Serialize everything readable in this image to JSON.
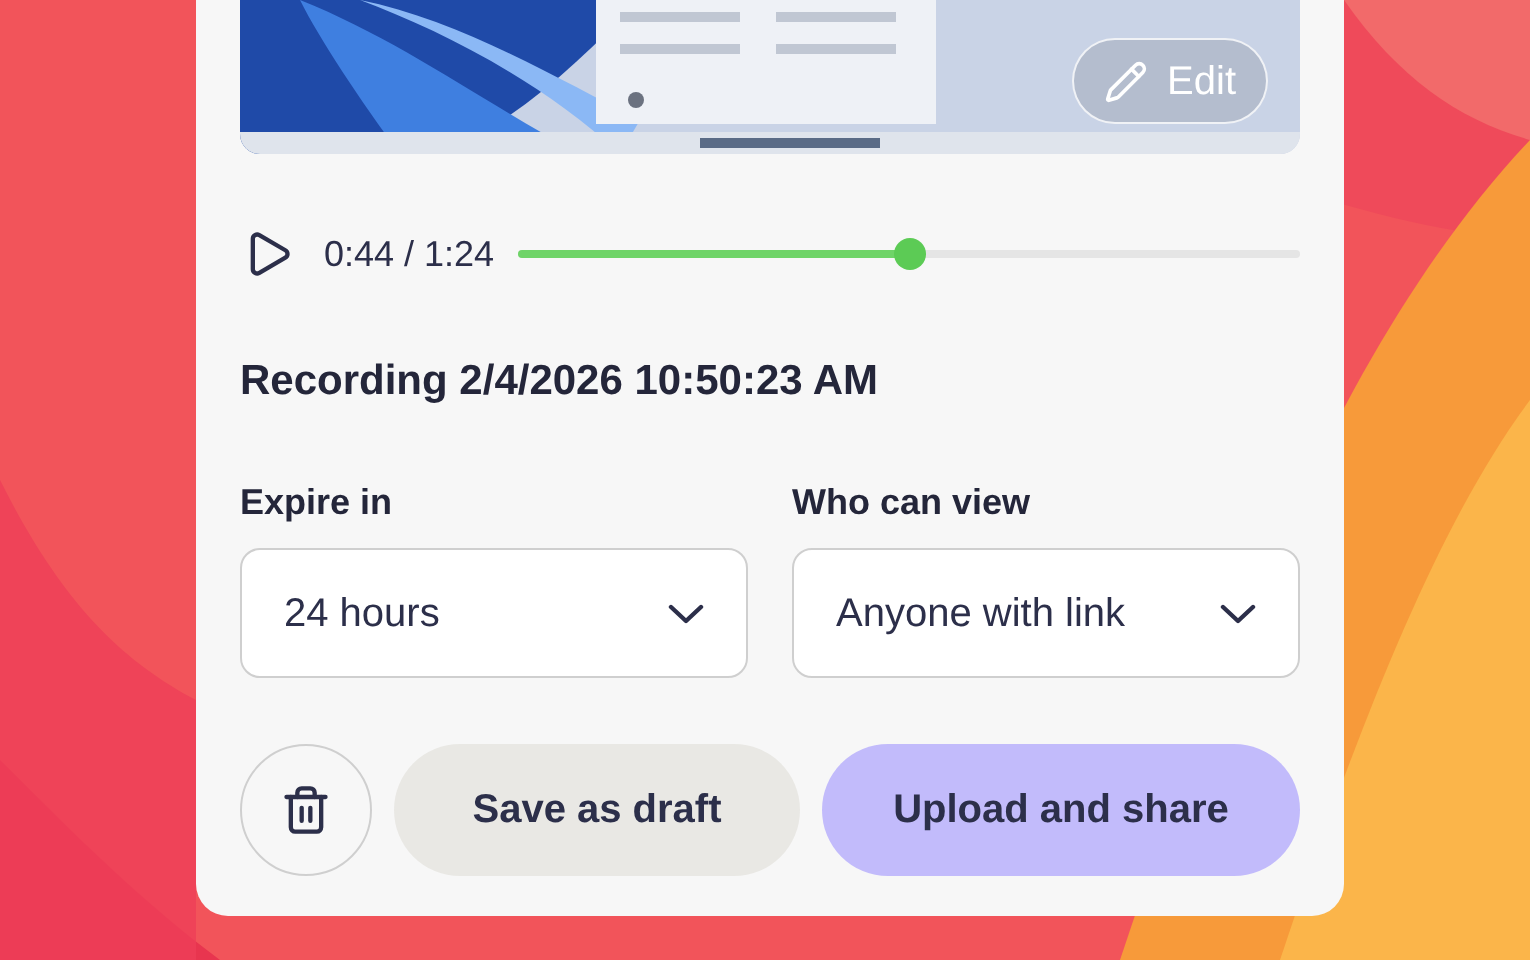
{
  "preview": {
    "kind": "picture",
    "edit_button": "Edit"
  },
  "player": {
    "time": "0:44 / 1:24",
    "level": 0.5
  },
  "recording_title": "Recording 2/4/2026 10:50:23 AM",
  "fields": [
    {
      "label": "Expire in",
      "value": "24 hours"
    },
    {
      "label": "Who can view",
      "value": "Anyone with link"
    }
  ],
  "buttons": [
    {
      "kind": "delete"
    },
    {
      "kind": "secondary",
      "label": "Save as draft"
    },
    {
      "kind": "primary",
      "label": "Upload and share"
    }
  ]
}
